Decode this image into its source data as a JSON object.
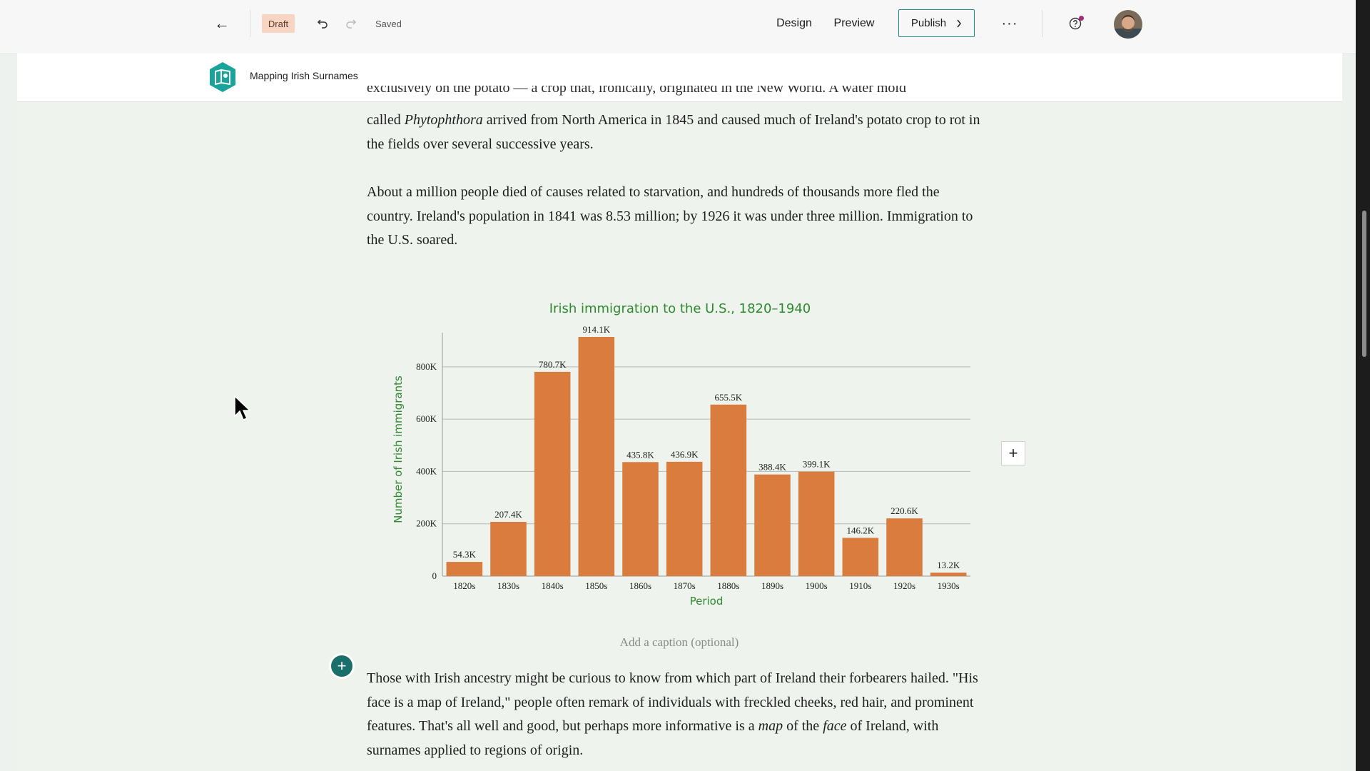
{
  "toolbar": {
    "back_icon": "arrow-left-icon",
    "draft_label": "Draft",
    "undo_icon": "undo-icon",
    "redo_icon": "redo-icon",
    "saved_label": "Saved",
    "design_label": "Design",
    "preview_label": "Preview",
    "publish_label": "Publish",
    "more_icon": "more-horizontal-icon",
    "help_icon": "help-circle-icon",
    "accent": "#1f8a82",
    "notification_color": "#a52a7e"
  },
  "story": {
    "title": "Mapping Irish Surnames",
    "logo_color": "#1aa39a"
  },
  "article": {
    "p0_clipped": "exclusively on the potato — a crop that, ironically, originated in the New World. A water mold",
    "p0_a": "called ",
    "p0_b": "Phytophthora",
    "p0_c": " arrived from North America in 1845 and caused much of Ireland's potato crop to rot in the fields over several successive years.",
    "p1": "About a million people died of causes related to starvation, and hundreds of thousands more fled the country. Ireland's population in 1841 was 8.53 million; by 1926 it was under three million. Immigration to the U.S. soared.",
    "caption_placeholder": "Add a caption (optional)",
    "p3_a": "Those with Irish ancestry might be curious to know from which part of Ireland their forbearers hailed. \"His face is a map of Ireland,\" people often remark of individuals with freckled cheeks, red hair, and prominent features. That's all well and good, but perhaps more informative is a ",
    "p3_b": "map",
    "p3_c": " of the ",
    "p3_d": "face",
    "p3_e": " of Ireland, with surnames applied to regions of origin."
  },
  "chart_data": {
    "type": "bar",
    "title": "Irish immigration to the U.S., 1820–1940",
    "xlabel": "Period",
    "ylabel": "Number of Irish immigrants",
    "categories": [
      "1820s",
      "1830s",
      "1840s",
      "1850s",
      "1860s",
      "1870s",
      "1880s",
      "1890s",
      "1900s",
      "1910s",
      "1920s",
      "1930s"
    ],
    "values": [
      54300,
      207400,
      780700,
      914100,
      435800,
      436900,
      655500,
      388400,
      399100,
      146200,
      220600,
      13200
    ],
    "value_labels": [
      "54.3K",
      "207.4K",
      "780.7K",
      "914.1K",
      "435.8K",
      "436.9K",
      "655.5K",
      "388.4K",
      "399.1K",
      "146.2K",
      "220.6K",
      "13.2K"
    ],
    "y_ticks": [
      0,
      200000,
      400000,
      600000,
      800000
    ],
    "y_tick_labels": [
      "0",
      "200K",
      "400K",
      "600K",
      "800K"
    ],
    "ylim": [
      0,
      914100
    ],
    "grid": true,
    "legend": "none",
    "bar_color": "#d97c3d",
    "title_color": "#2f8a2f"
  }
}
